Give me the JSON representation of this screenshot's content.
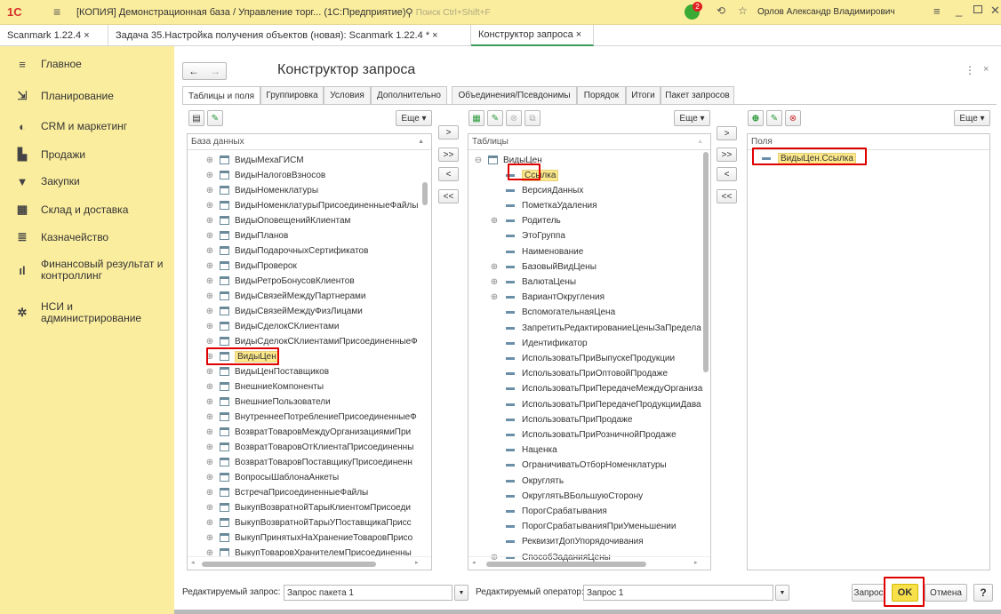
{
  "titlebar": {
    "logo": "1С",
    "title": "[КОПИЯ] Демонстрационная база / Управление торг...  (1С:Предприятие)",
    "search_placeholder": "Поиск Ctrl+Shift+F",
    "notify_count": "2",
    "user": "Орлов Александр Владимирович"
  },
  "tabs": [
    {
      "label": "Scanmark 1.22.4 ×"
    },
    {
      "label": "Задача 35.Настройка получения объектов (новая): Scanmark 1.22.4 * ×"
    },
    {
      "label": "Конструктор запроса ×"
    }
  ],
  "sidebar": {
    "items": [
      {
        "label": "Главное",
        "icon": "menu-icon"
      },
      {
        "label": "Планирование",
        "icon": "planning-icon"
      },
      {
        "label": "CRM и маркетинг",
        "icon": "crm-icon"
      },
      {
        "label": "Продажи",
        "icon": "sales-icon"
      },
      {
        "label": "Закупки",
        "icon": "cart-icon"
      },
      {
        "label": "Склад и доставка",
        "icon": "warehouse-icon"
      },
      {
        "label": "Казначейство",
        "icon": "treasury-icon"
      },
      {
        "label": "Финансовый результат и контроллинг",
        "icon": "chart-icon"
      },
      {
        "label": "НСИ и администрирование",
        "icon": "gear-icon"
      }
    ]
  },
  "form": {
    "title": "Конструктор запроса",
    "tabs": [
      {
        "label": "Таблицы и поля"
      },
      {
        "label": "Группировка"
      },
      {
        "label": "Условия"
      },
      {
        "label": "Дополнительно"
      },
      {
        "label": "Объединения/Псевдонимы"
      },
      {
        "label": "Порядок"
      },
      {
        "label": "Итоги"
      },
      {
        "label": "Пакет запросов"
      }
    ],
    "more_label": "Еще ▾",
    "db_header": "База данных",
    "tables_header": "Таблицы",
    "fields_header": "Поля",
    "move_right": ">",
    "move_all_right": ">>",
    "move_left": "<",
    "move_all_left": "<<",
    "database_items": [
      "ВидыМехаГИСМ",
      "ВидыНалоговВзносов",
      "ВидыНоменклатуры",
      "ВидыНоменклатурыПрисоединенныеФайлы",
      "ВидыОповещенийКлиентам",
      "ВидыПланов",
      "ВидыПодарочныхСертификатов",
      "ВидыПроверок",
      "ВидыРетроБонусовКлиентов",
      "ВидыСвязейМеждуПартнерами",
      "ВидыСвязейМеждуФизЛицами",
      "ВидыСделокСКлиентами",
      "ВидыСделокСКлиентамиПрисоединенныеФ",
      "ВидыЦен",
      "ВидыЦенПоставщиков",
      "ВнешниеКомпоненты",
      "ВнешниеПользователи",
      "ВнутреннееПотреблениеПрисоединенныеФ",
      "ВозвратТоваровМеждуОрганизациямиПри",
      "ВозвратТоваровОтКлиентаПрисоединенны",
      "ВозвратТоваровПоставщикуПрисоединенн",
      "ВопросыШаблонаАнкеты",
      "ВстречаПрисоединенныеФайлы",
      "ВыкупВозвратнойТарыКлиентомПрисоеди",
      "ВыкупВозвратнойТарыУПоставщикаПрисс",
      "ВыкупПринятыхНаХранениеТоваровПрисо",
      "ВыкупТоваровХранителемПрисоединенны"
    ],
    "tables_root": "ВидыЦен",
    "table_fields": [
      {
        "name": "Ссылка",
        "expandable": false
      },
      {
        "name": "ВерсияДанных",
        "expandable": false
      },
      {
        "name": "ПометкаУдаления",
        "expandable": false
      },
      {
        "name": "Родитель",
        "expandable": true
      },
      {
        "name": "ЭтоГруппа",
        "expandable": false
      },
      {
        "name": "Наименование",
        "expandable": false
      },
      {
        "name": "БазовыйВидЦены",
        "expandable": true
      },
      {
        "name": "ВалютаЦены",
        "expandable": true
      },
      {
        "name": "ВариантОкругления",
        "expandable": true
      },
      {
        "name": "ВспомогательнаяЦена",
        "expandable": false
      },
      {
        "name": "ЗапретитьРедактированиеЦеныЗаПредела",
        "expandable": false
      },
      {
        "name": "Идентификатор",
        "expandable": false
      },
      {
        "name": "ИспользоватьПриВыпускеПродукции",
        "expandable": false
      },
      {
        "name": "ИспользоватьПриОптовойПродаже",
        "expandable": false
      },
      {
        "name": "ИспользоватьПриПередачеМеждуОрганиза",
        "expandable": false
      },
      {
        "name": "ИспользоватьПриПередачеПродукцииДава",
        "expandable": false
      },
      {
        "name": "ИспользоватьПриПродаже",
        "expandable": false
      },
      {
        "name": "ИспользоватьПриРозничнойПродаже",
        "expandable": false
      },
      {
        "name": "Наценка",
        "expandable": false
      },
      {
        "name": "ОграничиватьОтборНоменклатуры",
        "expandable": false
      },
      {
        "name": "Округлять",
        "expandable": false
      },
      {
        "name": "ОкруглятьВБольшуюСторону",
        "expandable": false
      },
      {
        "name": "ПорогСрабатывания",
        "expandable": false
      },
      {
        "name": "ПорогСрабатыванияПриУменьшении",
        "expandable": false
      },
      {
        "name": "РеквизитДопУпорядочивания",
        "expandable": false
      },
      {
        "name": "СпособЗаданияЦены",
        "expandable": true
      }
    ],
    "selected_fields": [
      "ВидыЦен.Ссылка"
    ],
    "edited_query_label": "Редактируемый запрос:",
    "edited_query_value": "Запрос пакета 1",
    "edited_operator_label": "Редактируемый оператор:",
    "edited_operator_value": "Запрос 1",
    "query_button": "Запрос",
    "ok_button": "OK",
    "cancel_button": "Отмена",
    "help_button": "?"
  }
}
